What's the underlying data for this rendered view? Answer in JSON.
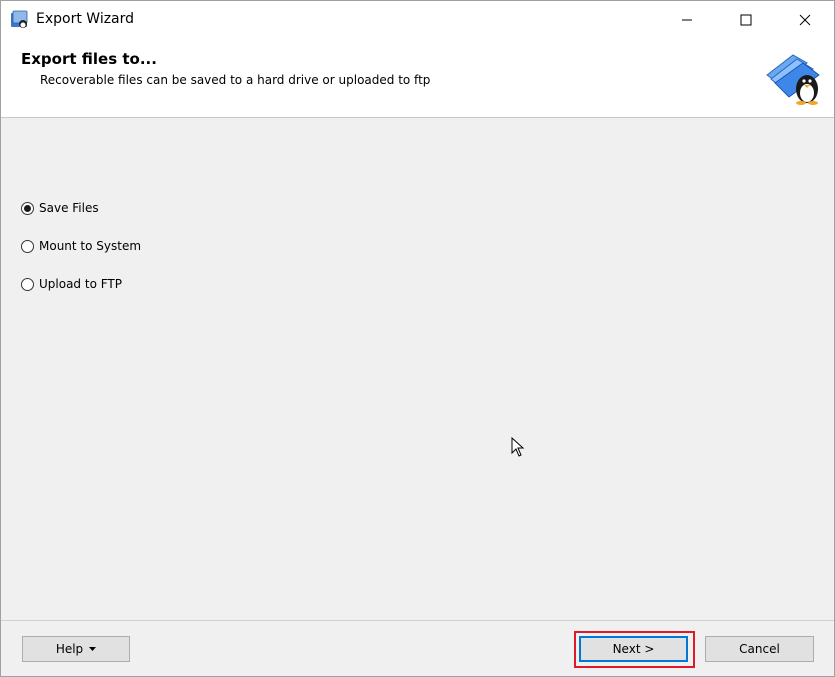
{
  "window": {
    "title": "Export Wizard",
    "controls": {
      "minimize": "minimize-icon",
      "maximize": "maximize-icon",
      "close": "close-icon"
    }
  },
  "header": {
    "title": "Export files to...",
    "subtitle": "Recoverable files can be saved to a hard drive or uploaded to ftp"
  },
  "options": [
    {
      "label": "Save Files",
      "selected": true
    },
    {
      "label": "Mount to System",
      "selected": false
    },
    {
      "label": "Upload to FTP",
      "selected": false
    }
  ],
  "footer": {
    "help_label": "Help",
    "next_label": "Next >",
    "cancel_label": "Cancel"
  },
  "colors": {
    "highlight": "#e0192a",
    "focus": "#0078d7",
    "button_face": "#e1e1e1",
    "dialog_bg": "#f0f0f0"
  }
}
